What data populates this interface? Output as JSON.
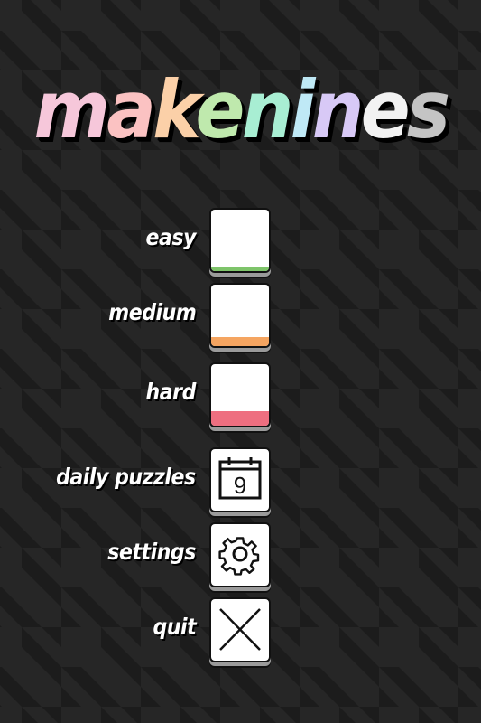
{
  "title": {
    "letters": [
      {
        "ch": "m",
        "color": "#f6c7da"
      },
      {
        "ch": "a",
        "color": "#fbc2c2"
      },
      {
        "ch": "k",
        "color": "#fbd0a8"
      },
      {
        "ch": "e",
        "color": "#bfe9ad"
      },
      {
        "ch": "n",
        "color": "#a8eed3"
      },
      {
        "ch": "i",
        "color": "#bfe9f6"
      },
      {
        "ch": "n",
        "color": "#d8c9f6"
      },
      {
        "ch": "e",
        "color": "#f2f2f2"
      },
      {
        "ch": "s",
        "color": "#c4c4c4"
      }
    ]
  },
  "menu": {
    "easy": {
      "label": "easy",
      "accent": "#7ec46a"
    },
    "medium": {
      "label": "medium",
      "accent": "#f5a561"
    },
    "hard": {
      "label": "hard",
      "accent": "#ee6f80"
    },
    "daily": {
      "label": "daily puzzles",
      "icon": "calendar-icon",
      "day": "9"
    },
    "settings": {
      "label": "settings",
      "icon": "gear-icon"
    },
    "quit": {
      "label": "quit",
      "icon": "close-icon"
    }
  }
}
